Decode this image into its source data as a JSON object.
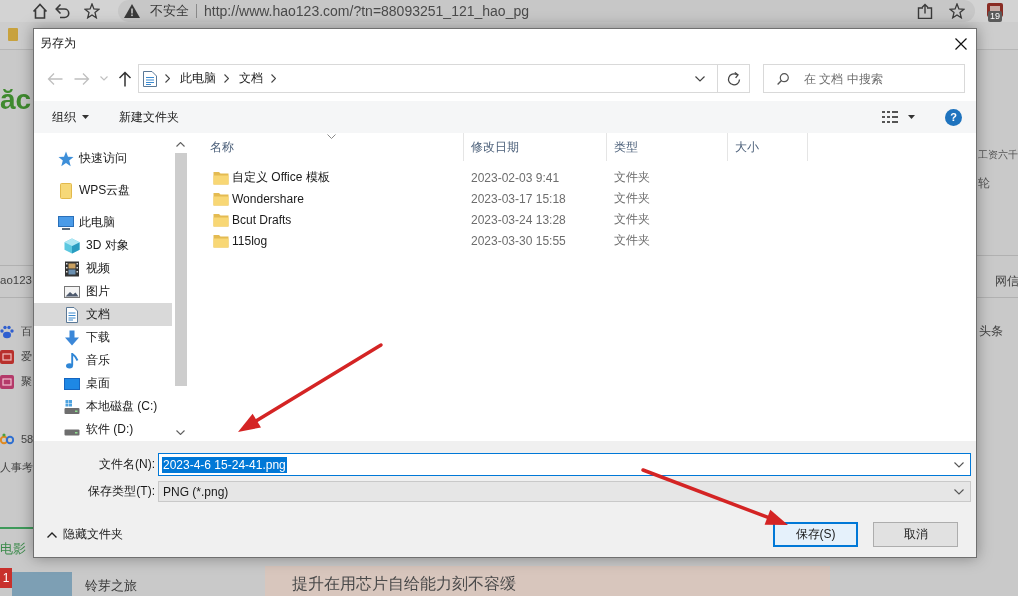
{
  "browser": {
    "security_label": "不安全",
    "url": "http://www.hao123.com/?tn=88093251_121_hao_pg",
    "extension_badge": "19"
  },
  "background_page": {
    "logo_text": "ăc",
    "left_column": {
      "site_label": "ao123",
      "links": [
        "百",
        "爱",
        "聚",
        "58"
      ],
      "notice": "人事考",
      "tab": "电影"
    },
    "right_column": {
      "news": [
        "工资六千",
        "轮"
      ],
      "tab": "网信",
      "links": [
        "头条"
      ]
    },
    "bottom": {
      "badge": "1",
      "movie_title": "铃芽之旅",
      "headline": "提升在用芯片自给能力刻不容缓"
    }
  },
  "dialog": {
    "title": "另存为",
    "navigation": {
      "back": {
        "disabled": true
      },
      "forward": {
        "disabled": true
      },
      "up": {
        "disabled": false
      }
    },
    "breadcrumb": [
      "此电脑",
      "文档"
    ],
    "search": {
      "placeholder": "在 文档 中搜索"
    },
    "toolbar": {
      "organize": "组织",
      "new_folder": "新建文件夹",
      "help": "?"
    },
    "sidebar": {
      "items": [
        {
          "label": "快速访问",
          "selected": false
        },
        {
          "label": "WPS云盘",
          "selected": false
        },
        {
          "label": "此电脑",
          "selected": false,
          "children": [
            {
              "label": "3D 对象",
              "selected": false
            },
            {
              "label": "视频",
              "selected": false
            },
            {
              "label": "图片",
              "selected": false
            },
            {
              "label": "文档",
              "selected": true
            },
            {
              "label": "下载",
              "selected": false
            },
            {
              "label": "音乐",
              "selected": false
            },
            {
              "label": "桌面",
              "selected": false
            },
            {
              "label": "本地磁盘 (C:)",
              "selected": false
            },
            {
              "label": "软件 (D:)",
              "selected": false
            }
          ]
        }
      ]
    },
    "table": {
      "columns": [
        {
          "label": "名称",
          "sorted": true
        },
        {
          "label": "修改日期",
          "sorted": false
        },
        {
          "label": "类型",
          "sorted": false
        },
        {
          "label": "大小",
          "sorted": false
        }
      ],
      "rows": [
        {
          "name": "自定义 Office 模板",
          "modified": "2023-02-03 9:41",
          "type": "文件夹"
        },
        {
          "name": "Wondershare",
          "modified": "2023-03-17 15:18",
          "type": "文件夹"
        },
        {
          "name": "Bcut Drafts",
          "modified": "2023-03-24 13:28",
          "type": "文件夹"
        },
        {
          "name": "115log",
          "modified": "2023-03-30 15:55",
          "type": "文件夹"
        }
      ]
    },
    "file_name": {
      "label": "文件名(N):",
      "value": "2023-4-6 15-24-41.png",
      "selected": true
    },
    "file_type": {
      "label": "保存类型(T):",
      "value": "PNG (*.png)"
    },
    "hide_folders": "隐藏文件夹",
    "buttons": [
      {
        "label": "保存(S)",
        "default": true
      },
      {
        "label": "取消",
        "default": false
      }
    ]
  },
  "annotations": [
    {
      "kind": "arrow"
    },
    {
      "kind": "arrow"
    }
  ]
}
